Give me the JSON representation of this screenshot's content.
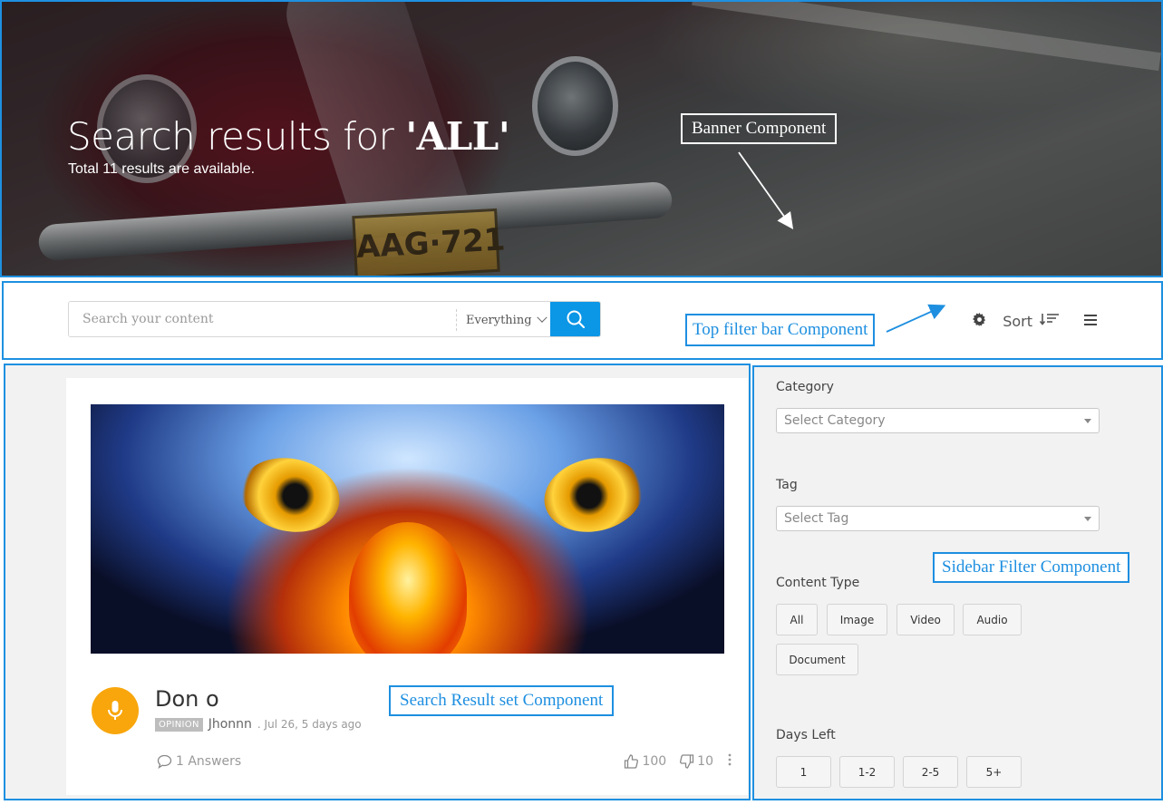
{
  "banner": {
    "title_prefix": "Search results for ",
    "query": "'ALL'",
    "subtitle": "Total 11 results are available.",
    "plate_text": "AAG·721"
  },
  "annotations": {
    "banner": "Banner Component",
    "top_filter": "Top filter bar Component",
    "sidebar": "Sidebar Filter Component",
    "results": "Search Result set Component"
  },
  "search": {
    "placeholder": "Search your content",
    "value": "",
    "scope": "Everything"
  },
  "toolbar": {
    "sort_label": "Sort"
  },
  "result": {
    "title": "Don o",
    "badge": "OPINION",
    "author": "Jhonnn",
    "date": ". Jul 26, 5 days ago",
    "answers": "1 Answers",
    "upvotes": "100",
    "downvotes": "10"
  },
  "sidebar": {
    "category_label": "Category",
    "category_placeholder": "Select Category",
    "tag_label": "Tag",
    "tag_placeholder": "Select Tag",
    "content_type_label": "Content Type",
    "content_types": [
      "All",
      "Image",
      "Video",
      "Audio",
      "Document"
    ],
    "days_left_label": "Days Left",
    "days_left": [
      "1",
      "1-2",
      "2-5",
      "5+"
    ]
  },
  "colors": {
    "annotation_blue": "#1e8fe0",
    "search_button": "#0b96e6",
    "avatar": "#f8a60c"
  }
}
